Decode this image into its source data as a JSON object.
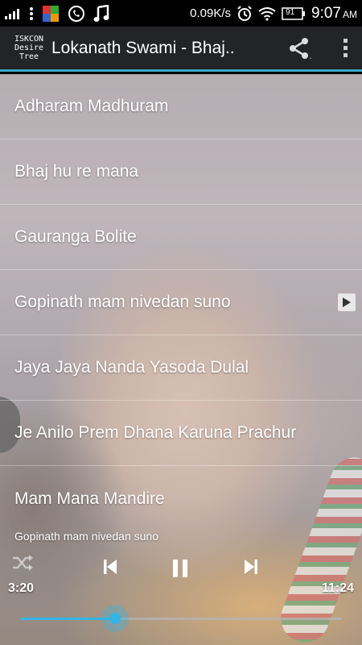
{
  "status_bar": {
    "net_speed": "0.09K/s",
    "battery": "91",
    "time": "9:07",
    "ampm": "AM"
  },
  "app_bar": {
    "logo_lines": [
      "ISKCON",
      "Desire",
      "Tree"
    ],
    "title": "Lokanath Swami - Bhaj.."
  },
  "songs": [
    {
      "label": "Adharam Madhuram"
    },
    {
      "label": "Bhaj hu re mana"
    },
    {
      "label": "Gauranga Bolite"
    },
    {
      "label": "Gopinath mam nivedan suno"
    },
    {
      "label": "Jaya Jaya Nanda Yasoda Dulal"
    },
    {
      "label": "Je Anilo Prem Dhana Karuna Prachur"
    },
    {
      "label": "Mam Mana Mandire"
    }
  ],
  "now_playing_index": 3,
  "player": {
    "track_name": "Gopinath mam nivedan suno",
    "elapsed": "3:20",
    "duration": "11:24",
    "progress": 0.295,
    "accent": "#33b5e5"
  }
}
